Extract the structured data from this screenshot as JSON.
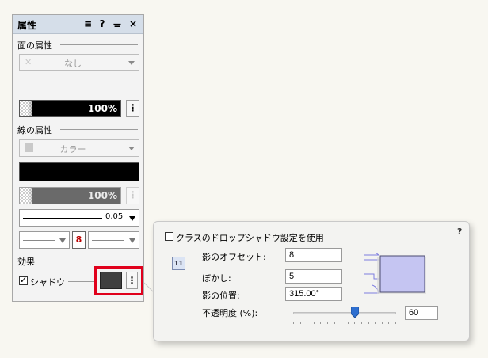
{
  "palette": {
    "title": "属性",
    "title_buttons": {
      "menu": "≡",
      "help": "?",
      "pin": "ᚚ",
      "close": "×"
    },
    "fill": {
      "section": "面の属性",
      "style": "なし",
      "opacity": "100%",
      "more": "⋮"
    },
    "line": {
      "section": "線の属性",
      "style": "カラー",
      "opacity": "100%",
      "more": "⋮",
      "thickness": "0.05",
      "link_badge": "8"
    },
    "effects": {
      "section": "効果",
      "shadow_label": "シャドウ",
      "shadow_checked": true,
      "more": "⋮"
    }
  },
  "shadow_popup": {
    "help": "?",
    "use_class_label": "クラスのドロップシャドウ設定を使用",
    "class_icon": "11",
    "offset_label": "影のオフセット:",
    "offset_value": "8",
    "blur_label": "ぼかし:",
    "blur_value": "5",
    "angle_label": "影の位置:",
    "angle_value": "315.00°",
    "opacity_label": "不透明度 (%):",
    "opacity_value": "60",
    "opacity_fraction": 0.6
  },
  "colors": {
    "highlight": "#e0001b",
    "shadow_swatch": "#404040",
    "titlebar": "#d5dee9"
  }
}
